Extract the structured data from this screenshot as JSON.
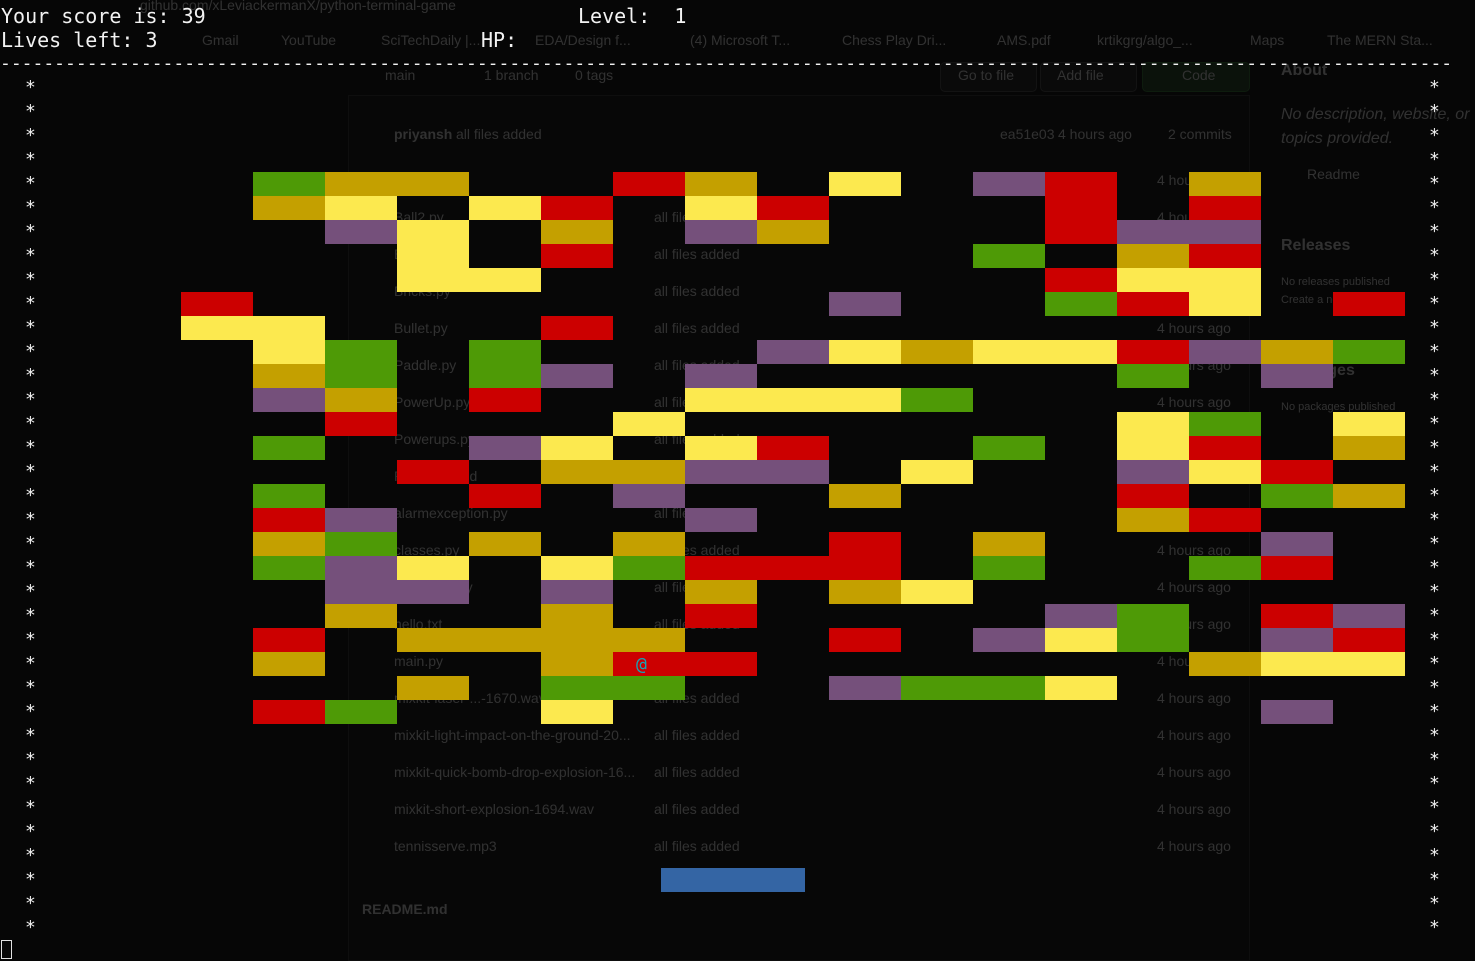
{
  "hud": {
    "score_text": "Your score is: 39",
    "level_text": "Level:  1",
    "lives_text": "Lives left: 3",
    "hp_text": "HP:"
  },
  "game": {
    "score": 39,
    "level": 1,
    "lives": 3,
    "wall_char": "*",
    "divider_char": "-",
    "ball_char": "@",
    "palette": {
      "G": "#4e9a06",
      "O": "#c4a000",
      "Y": "#fce94f",
      "R": "#cc0000",
      "P": "#75507b"
    },
    "paddle_color": "#3465a4",
    "ball_color": "#16a6b6",
    "brick_rows": [
      ".GOO..RO.Y.PR.O",
      ".OY.YR.YR...R.R",
      "..PY.O.PO...RPP",
      "...Y.R.....G.OR..O",
      "...YY.......RYY",
      "R........P..GRY.R",
      "YY...R...............",
      ".YG.G...PYOYYRPOGP",
      ".OG.GP.P.....G.P..R",
      ".PO.R..YYYG.......R",
      "..R...Y......YG.YO",
      ".G..PY.YR..G.YR.O.PP",
      "...R.OOPP.Y..PYR",
      ".G..R.P..O...R.GO.G",
      ".RP....P.....OR..OGOY",
      ".OG.O.O..R.O...P..O.P",
      ".GPY.YGRRR.G..GR.G",
      "..PP.P.O.OY.......",
      "..O..O.R....PG.RPR",
      ".R.OOOO..R.PYG.PR",
      ".O...ORR......OYYY..G",
      "...O.GG..PGGY",
      ".RG..Y.........P"
    ]
  },
  "ghost": {
    "url": "github.com/xLeviackermanX/python-terminal-game",
    "bookmarks": [
      "Gmail",
      "YouTube",
      "SciTechDaily |...",
      "EDA/Design f...",
      "(4) Microsoft T...",
      "Chess Play Dri...",
      "AMS.pdf",
      "krtikgrg/algo_...",
      "Maps",
      "The MERN Sta..."
    ],
    "branch": "main",
    "branches": "1 branch",
    "tags": "0 tags",
    "go_to_file": "Go to file",
    "add_file": "Add file",
    "code": "Code",
    "commit_author": "priyansh",
    "commit_msg": "all files added",
    "commit_hash": "ea51e03",
    "commit_time": "4 hours ago",
    "commits": "2 commits",
    "files": [
      {
        "name": "Ball.py",
        "msg": "all files added",
        "time": "4 hours ago"
      },
      {
        "name": "Ball2.py",
        "msg": "all files added",
        "time": "4 hours ago"
      },
      {
        "name": "Boss.py",
        "msg": "all files added",
        "time": "4 hours ago"
      },
      {
        "name": "Bricks.py",
        "msg": "all files added",
        "time": "4 hours ago"
      },
      {
        "name": "Bullet.py",
        "msg": "all files added",
        "time": "4 hours ago"
      },
      {
        "name": "Paddle.py",
        "msg": "all files added",
        "time": "4 hours ago"
      },
      {
        "name": "PowerUp.py",
        "msg": "all files added",
        "time": "4 hours ago"
      },
      {
        "name": "Powerups.py",
        "msg": "all files added",
        "time": "4 hours ago"
      },
      {
        "name": "README.md",
        "msg": "all files added",
        "time": "4 hours ago"
      },
      {
        "name": "alarmexception.py",
        "msg": "all files added",
        "time": "4 hours ago"
      },
      {
        "name": "classes.py",
        "msg": "all files added",
        "time": "4 hours ago"
      },
      {
        "name": "getchunix.py",
        "msg": "all files added",
        "time": "4 hours ago"
      },
      {
        "name": "hello.txt",
        "msg": "all files added",
        "time": "4 hours ago"
      },
      {
        "name": "main.py",
        "msg": "all files added",
        "time": "4 hours ago"
      },
      {
        "name": "mixkit-laser-...-1670.wav",
        "msg": "all files added",
        "time": "4 hours ago"
      },
      {
        "name": "mixkit-light-impact-on-the-ground-20...",
        "msg": "all files added",
        "time": "4 hours ago"
      },
      {
        "name": "mixkit-quick-bomb-drop-explosion-16...",
        "msg": "all files added",
        "time": "4 hours ago"
      },
      {
        "name": "mixkit-short-explosion-1694.wav",
        "msg": "all files added",
        "time": "4 hours ago"
      },
      {
        "name": "tennisserve.mp3",
        "msg": "all files added",
        "time": "4 hours ago"
      }
    ],
    "readme": "README.md",
    "about": "About",
    "about_desc": "No description, website, or topics provided.",
    "readme_link": "Readme",
    "releases": "Releases",
    "releases_desc": "No releases published",
    "releases_link": "Create a new release",
    "packages": "Packages",
    "packages_desc": "No packages published",
    "languages": "Languages"
  }
}
